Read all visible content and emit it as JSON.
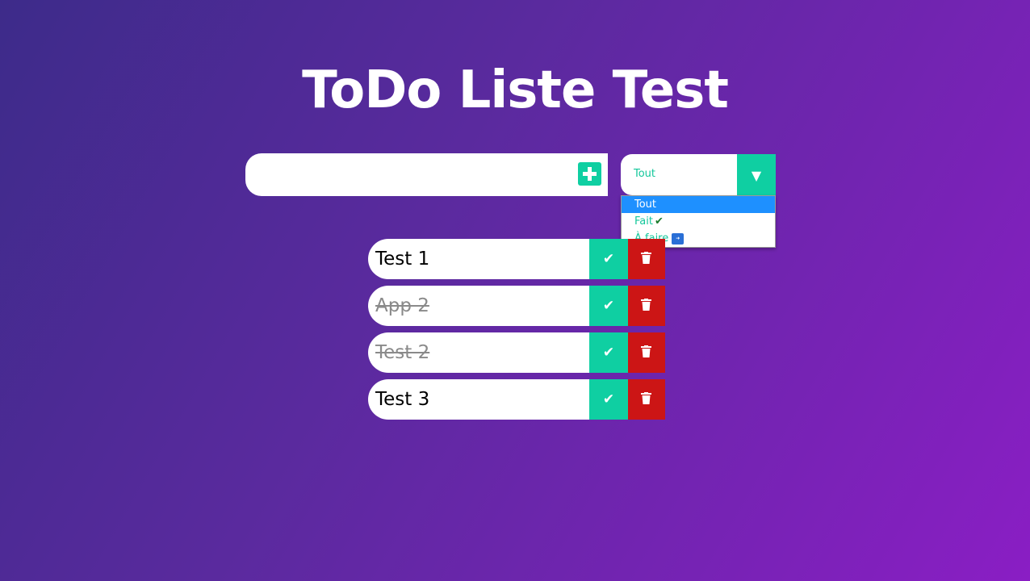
{
  "header": {
    "title": "ToDo Liste Test"
  },
  "form": {
    "input_value": "",
    "add_icon": "plus-icon",
    "filter": {
      "selected": "Tout",
      "options": [
        {
          "label": "Tout",
          "icon": ""
        },
        {
          "label": "Fait",
          "icon": "check-mark-icon"
        },
        {
          "label": "À faire",
          "icon": "soon-arrow-icon"
        }
      ]
    }
  },
  "todos": [
    {
      "text": "Test 1",
      "completed": false
    },
    {
      "text": "App 2",
      "completed": true
    },
    {
      "text": "Test 2",
      "completed": true
    },
    {
      "text": "Test 3",
      "completed": false
    }
  ],
  "colors": {
    "accent": "#0fcfa2",
    "delete": "#cc1515",
    "option_highlight": "#1e90ff",
    "gradient_start": "#3d2b8a",
    "gradient_end": "#8a1ec4"
  }
}
